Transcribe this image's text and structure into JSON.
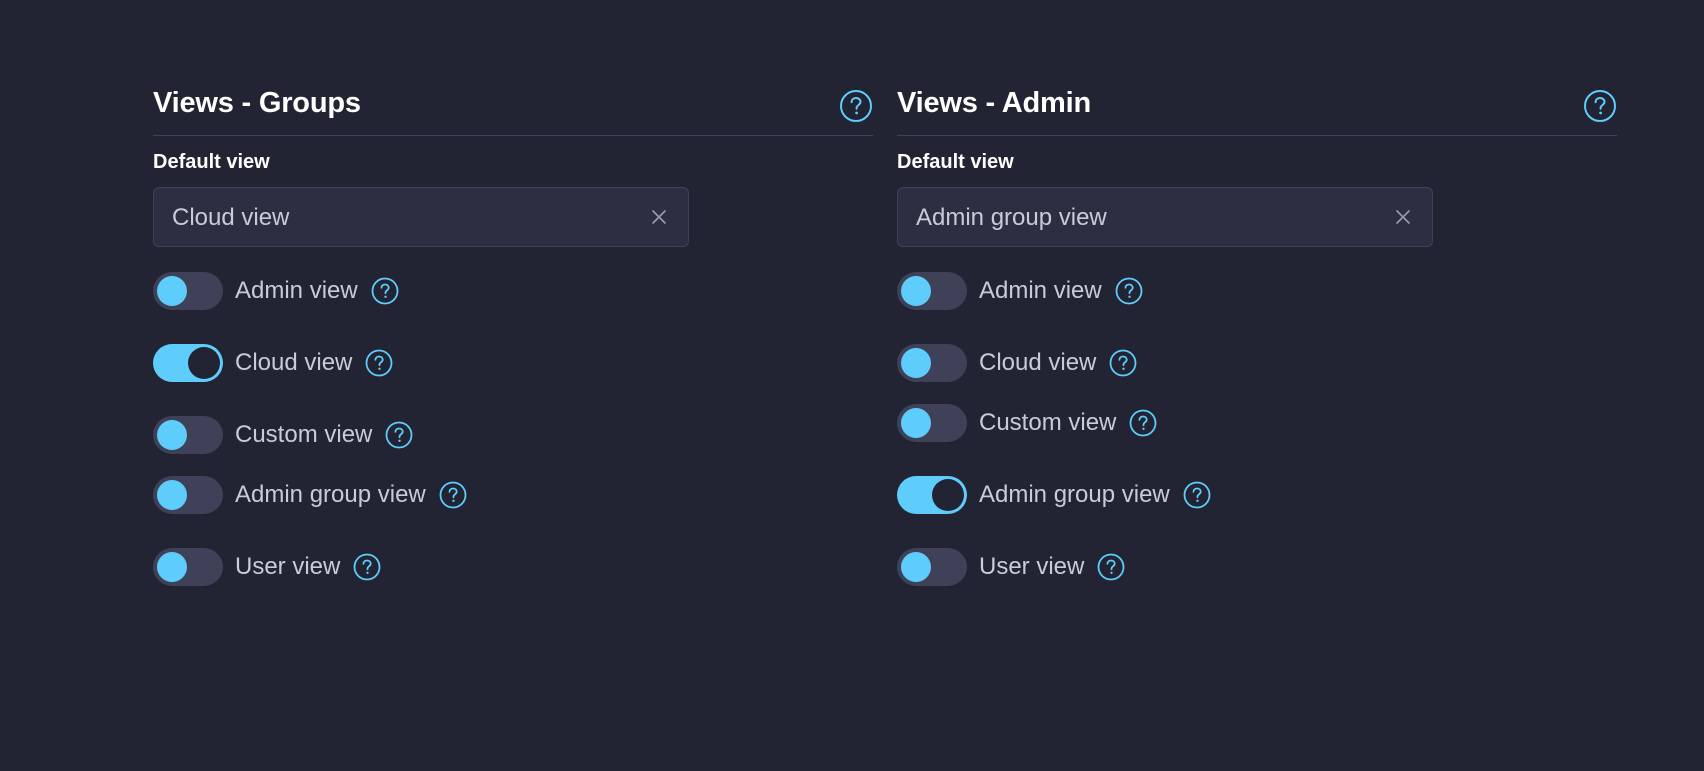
{
  "colors": {
    "background": "#222433",
    "accent": "#5ecdfb",
    "toggle_off_track": "#3e4157",
    "input_bg": "#2c2f42",
    "text_primary": "#ffffff",
    "text_secondary": "#c9cbd6"
  },
  "icons": {
    "help": "help-circle-icon",
    "clear": "close-icon"
  },
  "panels": [
    {
      "title": "Views - Groups",
      "default_view_label": "Default view",
      "default_view_value": "Cloud view",
      "toggles": [
        {
          "label": "Admin view",
          "on": false
        },
        {
          "label": "Cloud view",
          "on": true
        },
        {
          "label": "Custom view",
          "on": false
        },
        {
          "label": "Admin group view",
          "on": false
        },
        {
          "label": "User view",
          "on": false
        }
      ]
    },
    {
      "title": "Views - Admin",
      "default_view_label": "Default view",
      "default_view_value": "Admin group view",
      "toggles": [
        {
          "label": "Admin view",
          "on": false
        },
        {
          "label": "Cloud view",
          "on": false
        },
        {
          "label": "Custom view",
          "on": false
        },
        {
          "label": "Admin group view",
          "on": true
        },
        {
          "label": "User view",
          "on": false
        }
      ]
    }
  ]
}
